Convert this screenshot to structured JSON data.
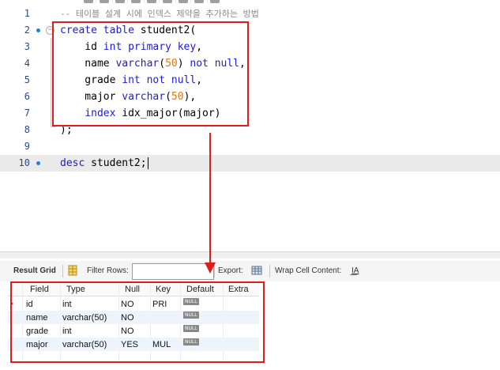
{
  "editor": {
    "lines": [
      {
        "num": "1",
        "text": "-- 테이블 설계 시에 인덱스 제약을 추가하는 방법"
      },
      {
        "num": "2"
      },
      {
        "num": "3"
      },
      {
        "num": "4"
      },
      {
        "num": "5"
      },
      {
        "num": "6"
      },
      {
        "num": "7"
      },
      {
        "num": "8"
      },
      {
        "num": "9"
      },
      {
        "num": "10"
      }
    ],
    "code": {
      "l2": [
        "create table",
        " student2("
      ],
      "l3": [
        "    id ",
        "int primary key",
        ","
      ],
      "l4": [
        "    name ",
        "varchar",
        "(",
        "50",
        ") ",
        "not null",
        ","
      ],
      "l5": [
        "    grade ",
        "int not null",
        ","
      ],
      "l6": [
        "    major ",
        "varchar",
        "(",
        "50",
        "),"
      ],
      "l7": [
        "    ",
        "index",
        " idx_major(major)"
      ],
      "l8": ");",
      "l10": [
        "desc",
        " student2;"
      ]
    },
    "fold_symbol": "−"
  },
  "result_toolbar": {
    "result_grid_label": "Result Grid",
    "filter_rows_label": "Filter Rows:",
    "filter_rows_value": "",
    "export_label": "Export:",
    "wrap_cell_label": "Wrap Cell Content:",
    "wrap_icon_text": "I͟A"
  },
  "result_grid": {
    "columns": [
      "Field",
      "Type",
      "Null",
      "Key",
      "Default",
      "Extra"
    ],
    "null_badge": "NULL",
    "rows": [
      {
        "field": "id",
        "type": "int",
        "null": "NO",
        "key": "PRI",
        "default": "NULL",
        "extra": ""
      },
      {
        "field": "name",
        "type": "varchar(50)",
        "null": "NO",
        "key": "",
        "default": "NULL",
        "extra": ""
      },
      {
        "field": "grade",
        "type": "int",
        "null": "NO",
        "key": "",
        "default": "NULL",
        "extra": ""
      },
      {
        "field": "major",
        "type": "varchar(50)",
        "null": "YES",
        "key": "MUL",
        "default": "NULL",
        "extra": ""
      }
    ]
  },
  "colors": {
    "annotation": "#e01d1d",
    "keyword": "#1c1cd6",
    "number": "#d97a17",
    "comment": "#8a8a8a"
  }
}
